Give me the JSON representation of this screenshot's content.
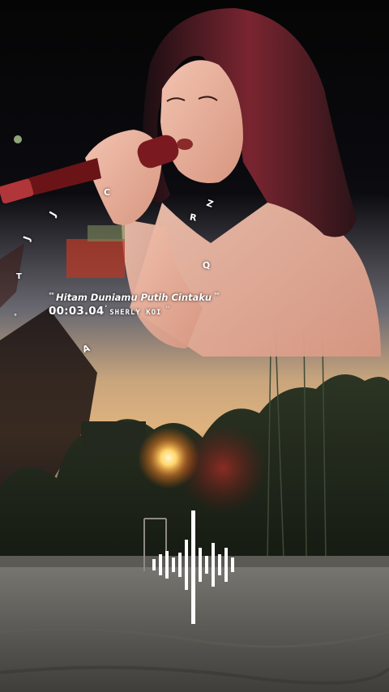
{
  "song": {
    "title": "Hitam Duniamu Putih Cintaku",
    "time": "00:03.04",
    "artist": "SHERLY KOI"
  },
  "floating_letters": [
    "C",
    "Z",
    "J",
    "R",
    "T",
    "Q",
    "A"
  ],
  "colors": {
    "text": "#ffffff",
    "accent_red": "#d8282f",
    "sunset_glow": "#ffd56a"
  },
  "icons": {
    "equalizer": "audio-waveform-icon",
    "title_marks": "double-quote-marks"
  }
}
